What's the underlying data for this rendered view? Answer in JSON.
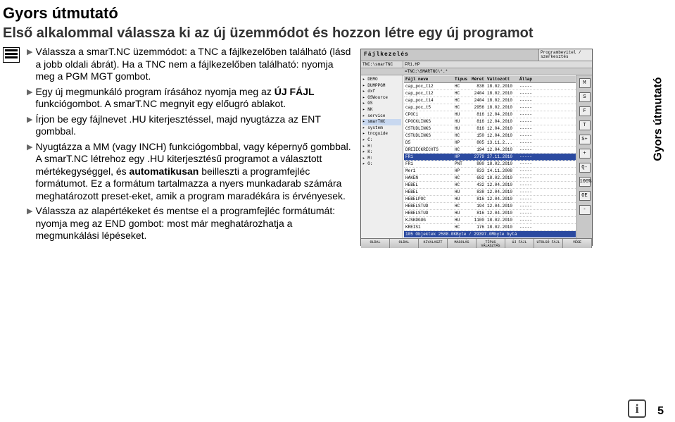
{
  "title": "Gyors útmutató",
  "subtitle": "Első alkalommal válassza ki az új üzemmódot és hozzon létre egy új programot",
  "side_label": "Gyors útmutató",
  "page_number": "5",
  "bullets": [
    {
      "pre": "Válassza a smarT.NC üzemmódot: a TNC a fájlkezelőben található (lásd a jobb oldali ábrát). Ha a TNC nem a fájlkezelőben található: nyomja meg a PGM MGT gombot."
    },
    {
      "pre": "Egy új megmunkáló program írásához nyomja meg az ",
      "bold1": "ÚJ FÁJL",
      "mid": " funkciógombot. A smarT.NC megnyit egy előugró ablakot."
    },
    {
      "pre": "Írjon be egy fájlnevet .HU kiterjesztéssel, majd nyugtázza az ENT gombbal."
    },
    {
      "pre": "Nyugtázza a MM (vagy INCH) funkciógombbal, vagy képernyő gombbal. A smarT.NC létrehoz egy .HU kiterjesztésű programot a választott mértékegységgel, és ",
      "bold1": "automatikusan",
      "mid": " beilleszti a programfejléc formátumot. Ez a formátum tartalmazza a nyers munkadarab számára meghatározott preset-eket, amik a program maradékára is érvényesek."
    },
    {
      "pre": "Válassza az alapértékeket és mentse el a programfejléc formátumát: nyomja meg az END gombot: most már meghatározhatja a megmunkálási lépéseket."
    }
  ],
  "shot": {
    "title": "Fájlkezelés",
    "right_panel": "Programbevitel / szerkesztés",
    "path_left": "TNC:\\smarTNC",
    "path_right": "FR1.HP",
    "tabstrip": "=TNC:\\SMARTNC\\*.*",
    "tree": [
      "▸ DEMO",
      "▸ DUMPPGM",
      "▸ dxf",
      "▸ GSWource",
      "▸ GS",
      "▸ NK",
      "▸ service",
      "▸ smarTNC",
      "▸ system",
      "▸ tncguide",
      "▸ C:",
      "▸ H:",
      "▸ K:",
      "▸ M:",
      "▸ O:"
    ],
    "list_headers": {
      "name": "Fájl neve",
      "type": "Típus",
      "size": "Méret",
      "date": "Változott",
      "stat": "Állap"
    },
    "files": [
      {
        "n": "cap_poc_t12",
        "t": "HC",
        "s": "838",
        "d": "18.02.2010",
        "st": "-----"
      },
      {
        "n": "cap_poc_t12",
        "t": "HC",
        "s": "2404",
        "d": "18.02.2010",
        "st": "-----"
      },
      {
        "n": "cap_poc_t14",
        "t": "HC",
        "s": "2404",
        "d": "18.02.2010",
        "st": "-----"
      },
      {
        "n": "cap_poc_t5",
        "t": "HC",
        "s": "2956",
        "d": "18.02.2010",
        "st": "-----"
      },
      {
        "n": "CPOC1",
        "t": "HU",
        "s": "816",
        "d": "12.04.2010",
        "st": "-----"
      },
      {
        "n": "CPOCKLINKS",
        "t": "HU",
        "s": "816",
        "d": "12.04.2010",
        "st": "-----"
      },
      {
        "n": "CSTUDLINKS",
        "t": "HU",
        "s": "816",
        "d": "12.04.2010",
        "st": "-----"
      },
      {
        "n": "CSTUDLINKS",
        "t": "HC",
        "s": "150",
        "d": "12.04.2010",
        "st": "-----"
      },
      {
        "n": "D5",
        "t": "HP",
        "s": "805",
        "d": "13.11.2...",
        "st": "-----"
      },
      {
        "n": "DREIECKRECHTS",
        "t": "HC",
        "s": "194",
        "d": "12.04.2010",
        "st": "-----"
      },
      {
        "n": "FR1",
        "t": "HP",
        "s": "2779",
        "d": "27.11.2010",
        "st": "-----",
        "sel": true
      },
      {
        "n": "FR1",
        "t": "PNT",
        "s": "880",
        "d": "18.02.2010",
        "st": "-----"
      },
      {
        "n": "Mer1",
        "t": "HP",
        "s": "833",
        "d": "14.11.2008",
        "st": "-----"
      },
      {
        "n": "HAKEN",
        "t": "HC",
        "s": "682",
        "d": "18.02.2010",
        "st": "-----"
      },
      {
        "n": "HEBEL",
        "t": "HC",
        "s": "432",
        "d": "12.04.2010",
        "st": "-----"
      },
      {
        "n": "HEBEL",
        "t": "HU",
        "s": "838",
        "d": "12.04.2010",
        "st": "-----"
      },
      {
        "n": "HEBELPOC",
        "t": "HU",
        "s": "816",
        "d": "12.04.2010",
        "st": "-----"
      },
      {
        "n": "HEBELSTUD",
        "t": "HC",
        "s": "194",
        "d": "12.04.2010",
        "st": "-----"
      },
      {
        "n": "HEBELSTUD",
        "t": "HU",
        "s": "816",
        "d": "12.04.2010",
        "st": "-----"
      },
      {
        "n": "KJSKDGUG",
        "t": "HU",
        "s": "1100",
        "d": "18.02.2010",
        "st": "-----"
      },
      {
        "n": "KREIS1",
        "t": "HC",
        "s": "176",
        "d": "18.02.2010",
        "st": "-----"
      }
    ],
    "status_bar": "105 Objektek 2588.0KByte / 29397.0Mbyte bytá",
    "side_buttons": [
      "M",
      "S",
      "F",
      "T",
      "S+",
      "+",
      "Q-",
      "100%",
      "OE",
      "-"
    ],
    "softkeys": [
      "OLDAL",
      "OLDAL",
      "KIVÁLASZT",
      "MÁSOLÁS",
      "TÍPUS VÁLASZTÁS",
      "ÚJ FÁJL",
      "UTOLSÓ FÁJL",
      "VÉGE"
    ]
  }
}
